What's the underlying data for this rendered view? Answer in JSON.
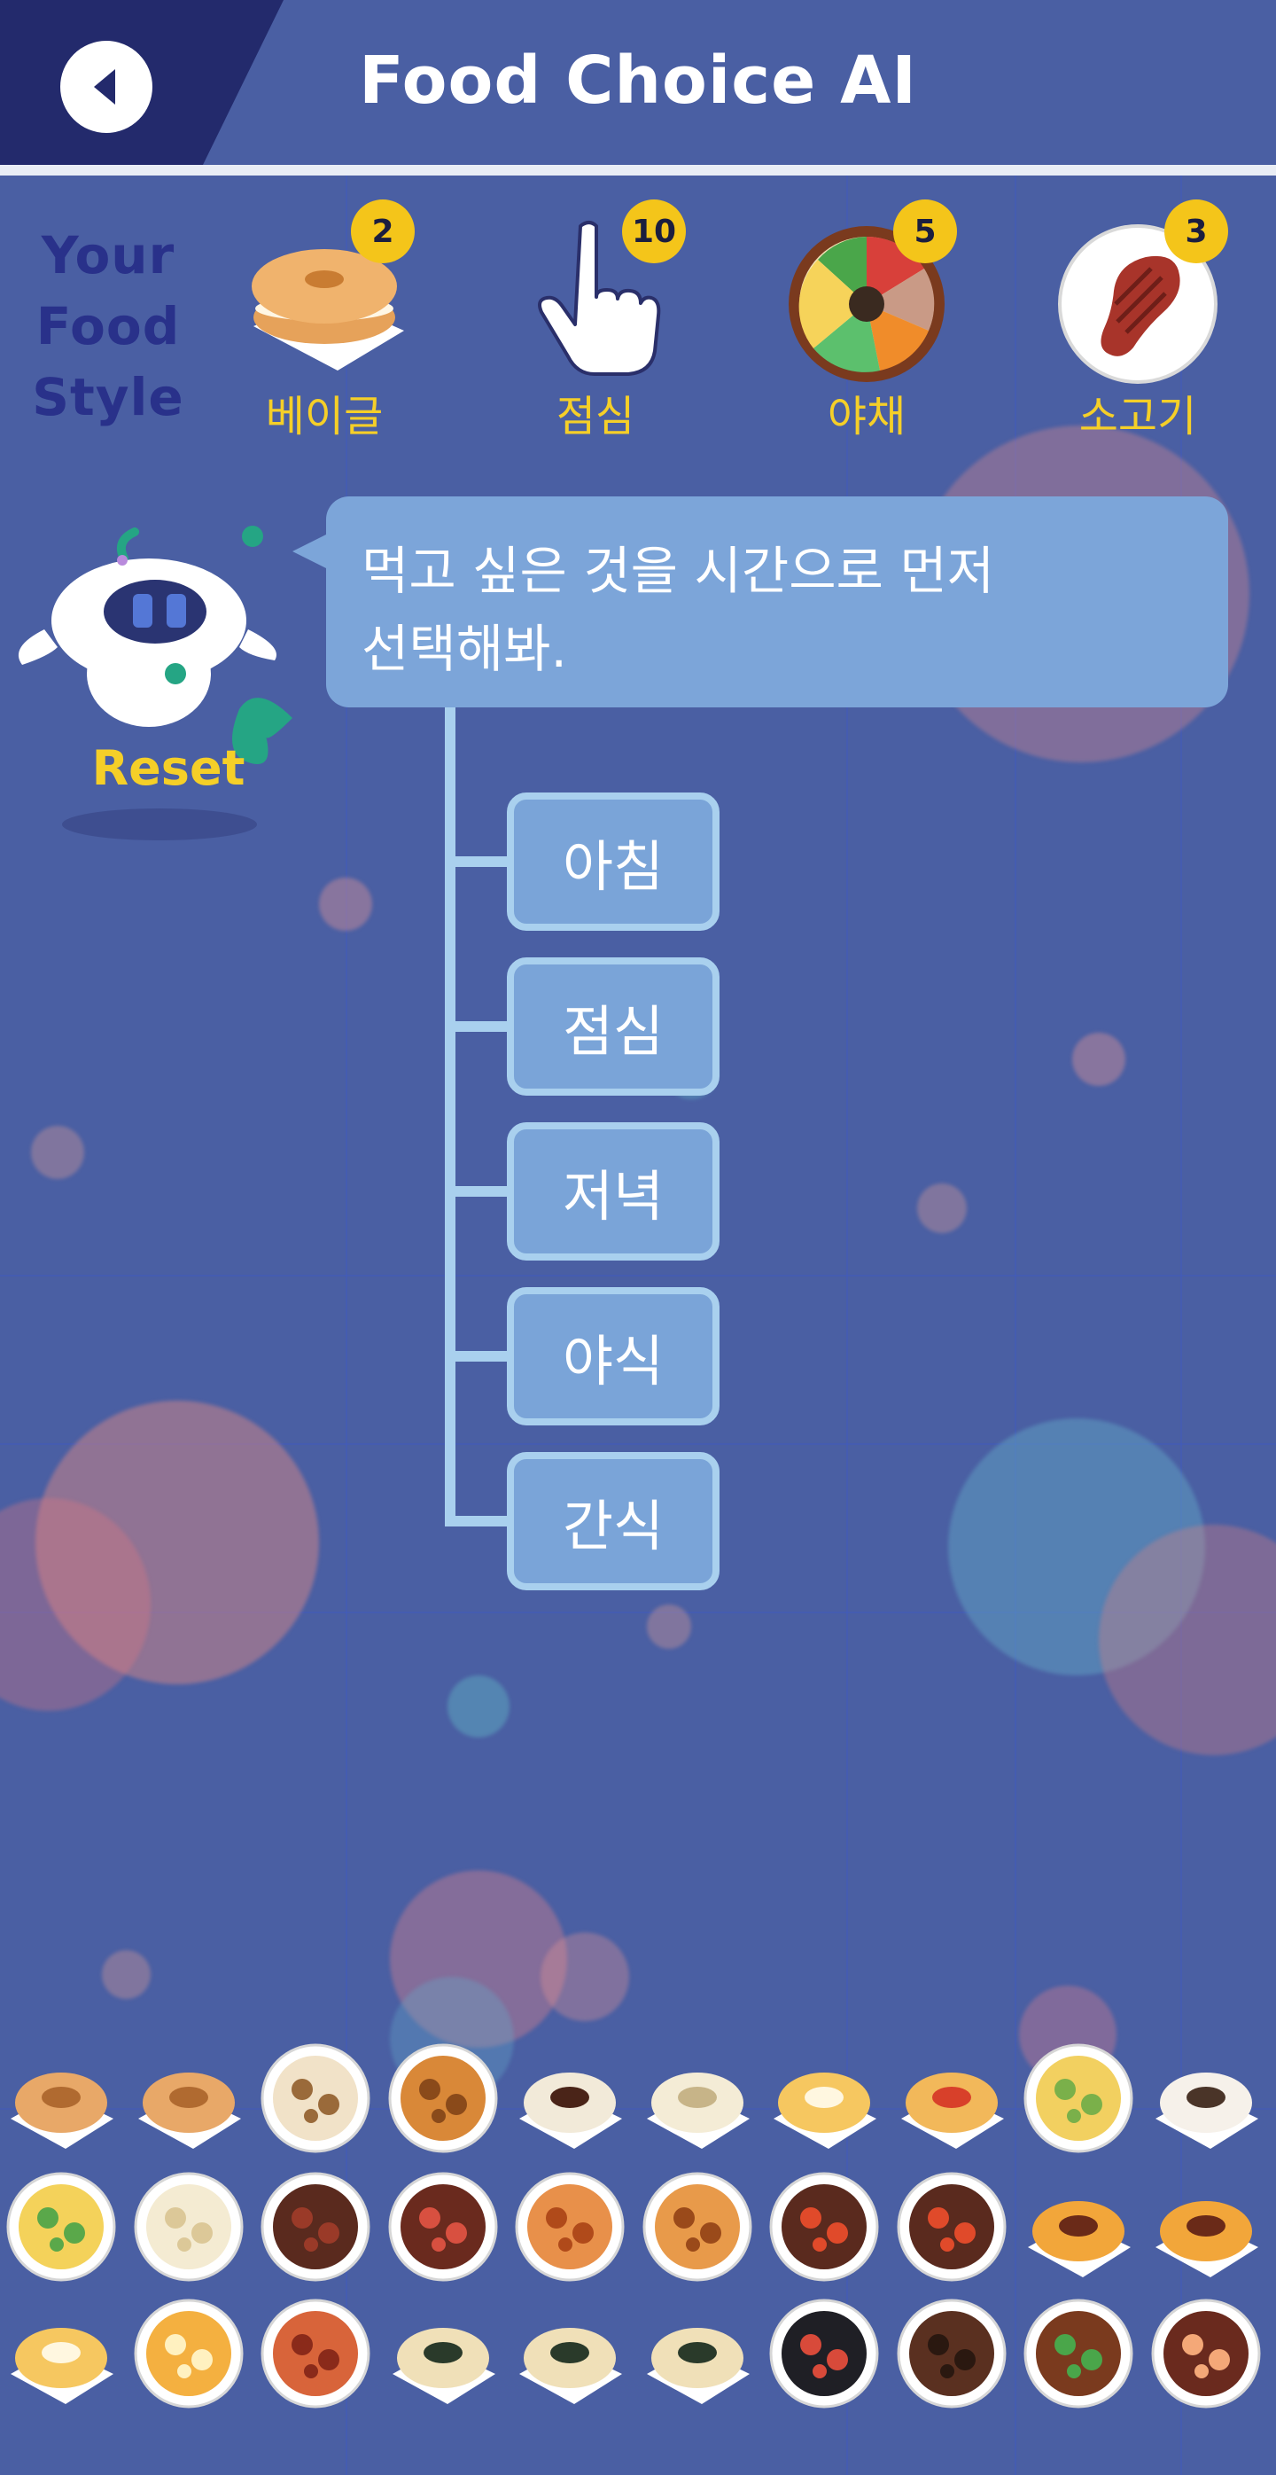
{
  "header": {
    "title": "Food Choice AI"
  },
  "style": {
    "label_lines": [
      "Your",
      "Food",
      "Style"
    ],
    "items": [
      {
        "label": "베이글",
        "count": "2",
        "icon": "bagel-icon"
      },
      {
        "label": "점심",
        "count": "10",
        "icon": "pointing-hand-icon"
      },
      {
        "label": "야채",
        "count": "5",
        "icon": "bibimbap-icon"
      },
      {
        "label": "소고기",
        "count": "3",
        "icon": "steak-icon"
      }
    ]
  },
  "robot": {
    "reset_label": "Reset"
  },
  "bubble": {
    "line1": "먹고 싶은 것을 시간으로 먼저",
    "line2": "선택해봐."
  },
  "options": [
    "아침",
    "점심",
    "저녁",
    "야식",
    "간식"
  ],
  "food_tray": [
    [
      "fish-bread",
      "fish-bread",
      "skewer",
      "sausage",
      "red-bean-bun",
      "steamed-bun",
      "egg-toast",
      "pizza-toast",
      "fried-rice",
      "dumpling"
    ],
    [
      "pea-omelette",
      "tofu",
      "meatball-stew",
      "spicy-soup",
      "skewer-plate",
      "chicken-skewer",
      "tteokbokki",
      "tteokbokki",
      "burger",
      "burger"
    ],
    [
      "egg-toast",
      "egg-rice",
      "spaghetti",
      "kimbap",
      "kimbap",
      "kimbap",
      "beef-bowl",
      "bulgogi-bowl",
      "bibimbap",
      "seafood-soup"
    ]
  ],
  "colors": {
    "background": "#4a5fa3",
    "header_dark": "#232a6c",
    "accent": "#f5cf28",
    "bubble": "#7ca5d9",
    "option": "#7aa4d8",
    "badge": "#f4c51a"
  }
}
